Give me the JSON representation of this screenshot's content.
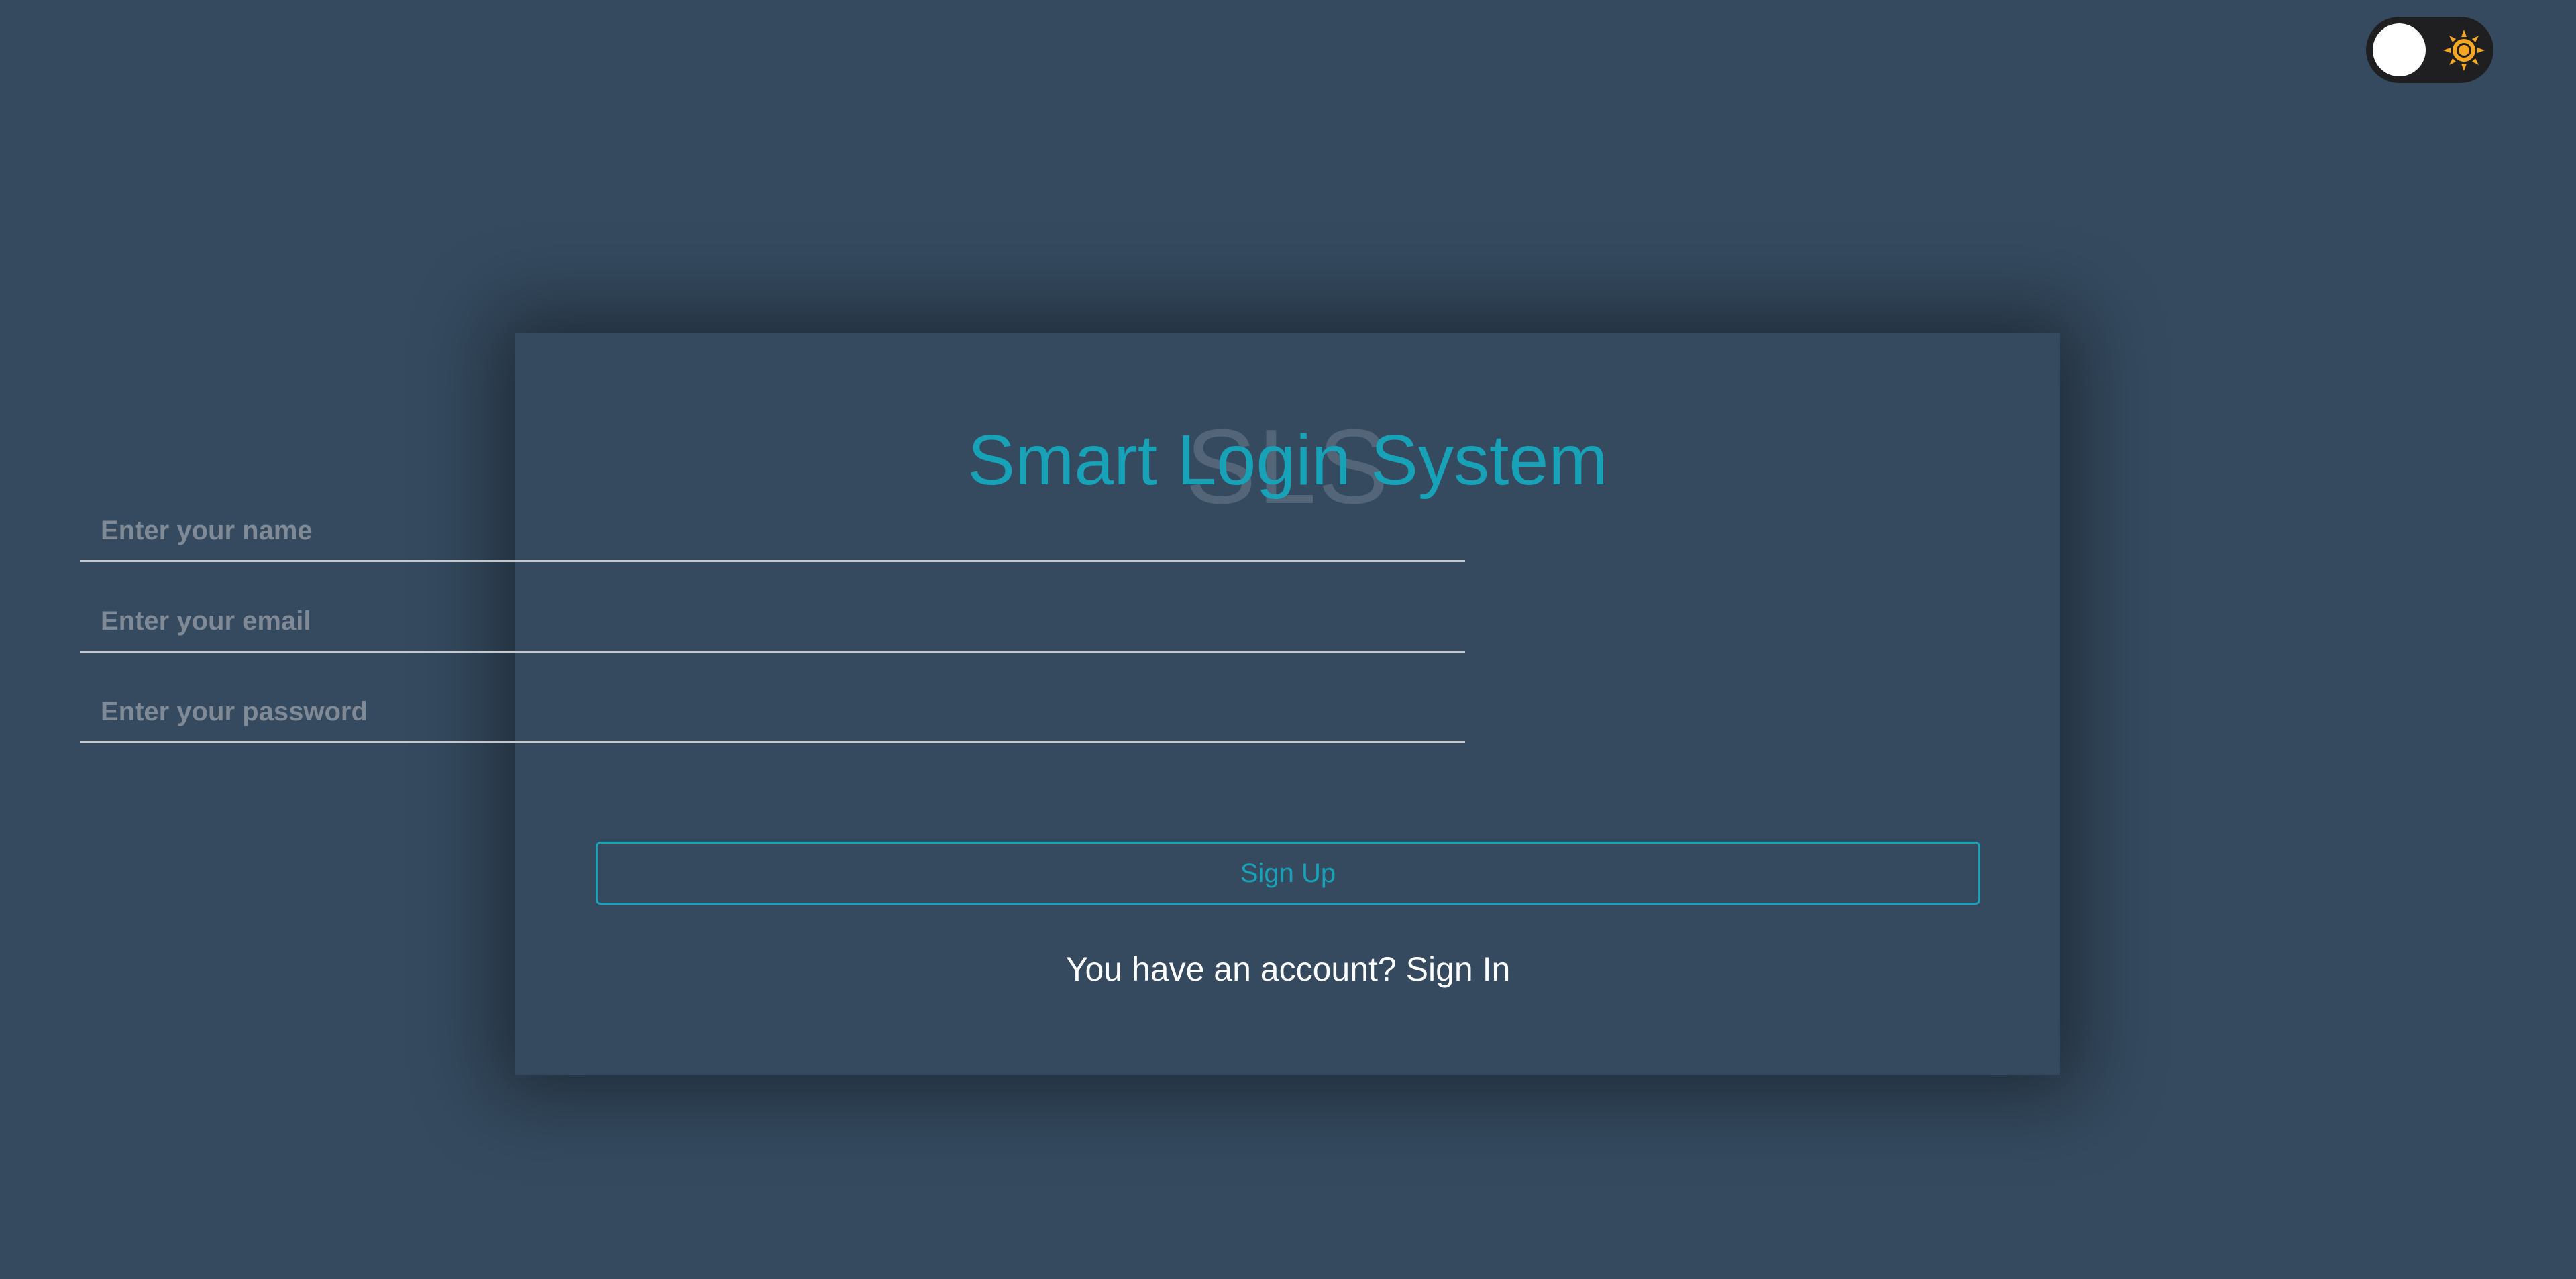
{
  "theme_toggle": {
    "knob_icon": "white-circle",
    "sun_icon": "sun-icon",
    "sun_color": "#f5a623",
    "track_color": "#1f1f22"
  },
  "card": {
    "watermark": "SLS",
    "title": "Smart Login System",
    "name_placeholder": "Enter your name",
    "email_placeholder": "Enter your email",
    "password_placeholder": "Enter your password",
    "signup_label": "Sign Up",
    "account_prompt": "You have an account?",
    "signin_label": "Sign In"
  },
  "colors": {
    "background": "#354a5f",
    "accent": "#17a2b8",
    "text": "#ffffff",
    "placeholder": "#7f8a96"
  }
}
